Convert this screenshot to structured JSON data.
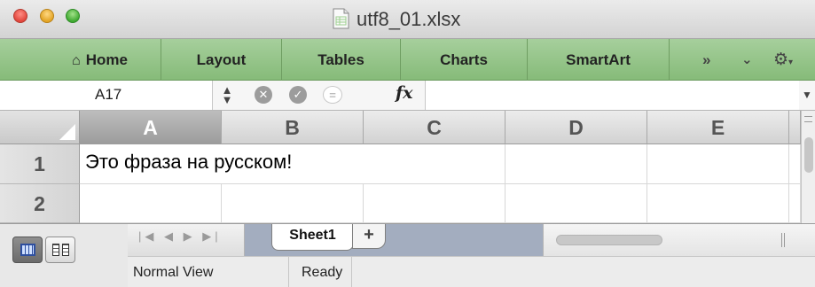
{
  "window": {
    "title": "utf8_01.xlsx"
  },
  "ribbon": {
    "tabs": [
      {
        "label": "Home",
        "icon": "home-icon"
      },
      {
        "label": "Layout"
      },
      {
        "label": "Tables"
      },
      {
        "label": "Charts"
      },
      {
        "label": "SmartArt"
      }
    ],
    "overflow_glyph": "»",
    "accent_color": "#97c58b"
  },
  "formula_bar": {
    "name_box": "A17",
    "fx_label": "fx",
    "formula_value": ""
  },
  "sheet": {
    "columns": [
      "A",
      "B",
      "C",
      "D",
      "E"
    ],
    "selected_column": "A",
    "rows": [
      {
        "label": "1",
        "cells": [
          "Это фраза на русском!",
          "",
          "",
          "",
          ""
        ]
      },
      {
        "label": "2",
        "cells": [
          "",
          "",
          "",
          "",
          ""
        ]
      }
    ]
  },
  "sheet_tabs": {
    "tabs": [
      {
        "label": "Sheet1",
        "active": true
      }
    ],
    "add_label": "+"
  },
  "status_bar": {
    "view_label": "Normal View",
    "state": "Ready"
  }
}
